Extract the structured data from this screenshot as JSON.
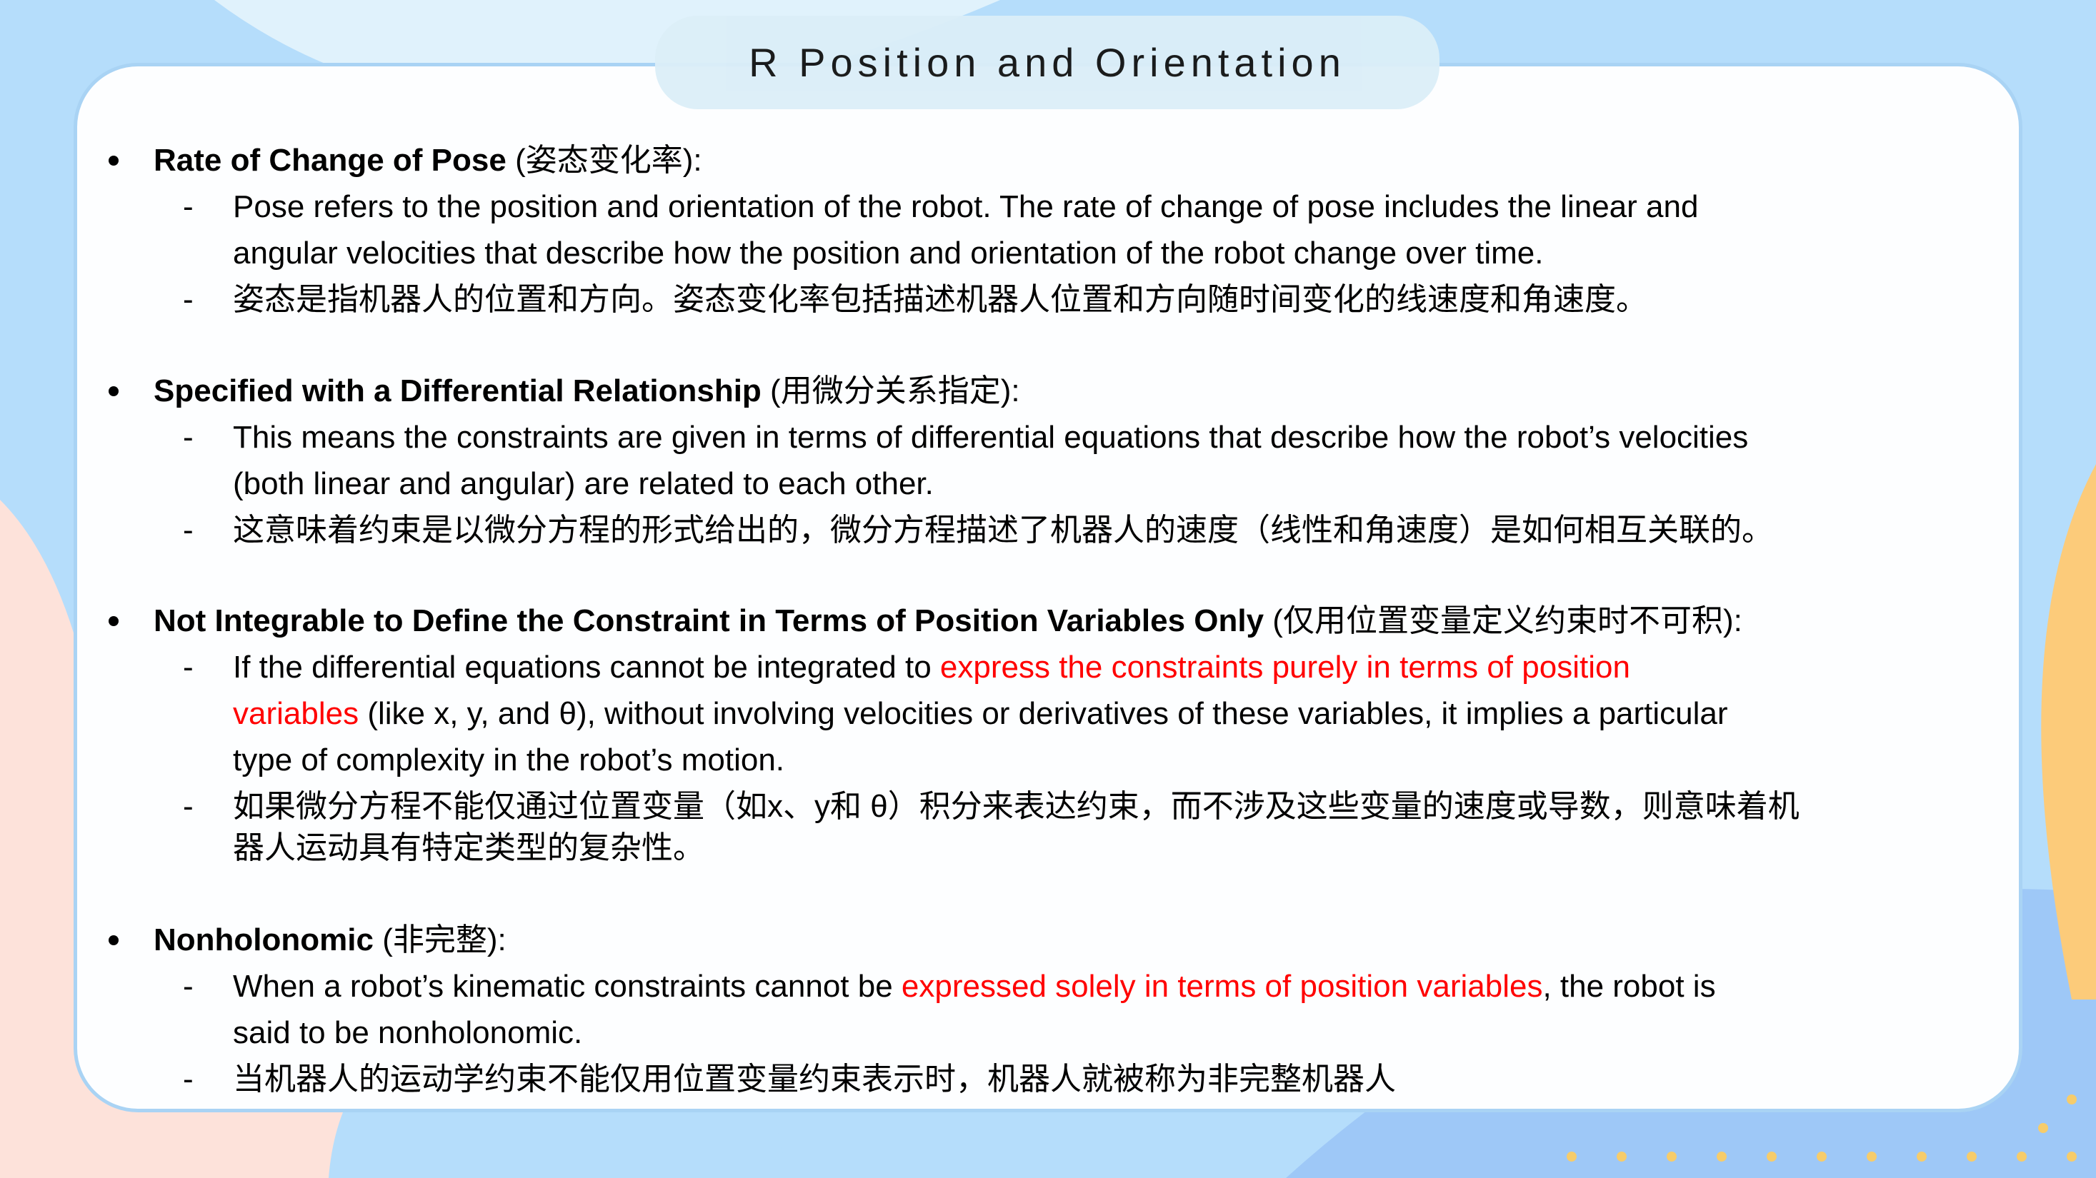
{
  "title": "R Position and Orientation",
  "colors": {
    "highlight": "#ff0000",
    "card_border": "#a9d3f4",
    "background": "#b5ddfb"
  },
  "sections": [
    {
      "heading": "Rate of Change of Pose",
      "heading_suffix": " (姿态变化率):",
      "items": [
        [
          [
            {
              "t": "Pose refers to the position and orientation of the robot. The rate of change of pose includes the linear and"
            }
          ],
          [
            {
              "t": "angular velocities that describe how the position and orientation of the robot change over time."
            }
          ]
        ],
        [
          [
            {
              "t": "姿态是指机器人的位置和方向。姿态变化率包括描述机器人位置和方向随时间变化的线速度和角速度。"
            }
          ]
        ]
      ]
    },
    {
      "heading": "Specified with a Differential Relationship",
      "heading_suffix": " (用微分关系指定):",
      "items": [
        [
          [
            {
              "t": "This means the constraints are given in terms of differential equations that describe how the robot’s velocities"
            }
          ],
          [
            {
              "t": "(both linear and angular) are related to each other."
            }
          ]
        ],
        [
          [
            {
              "t": "这意味着约束是以微分方程的形式给出的，微分方程描述了机器人的速度（线性和角速度）是如何相互关联的。"
            }
          ]
        ]
      ]
    },
    {
      "heading": "Not Integrable to Define the Constraint in Terms of Position Variables Only",
      "heading_suffix": " (仅用位置变量定义约束时不可积):",
      "items": [
        [
          [
            {
              "t": "If the differential equations cannot be integrated to "
            },
            {
              "t": "express the constraints purely in terms of position",
              "red": true
            }
          ],
          [
            {
              "t": "variables",
              "red": true
            },
            {
              "t": " (like x, y, and θ), without involving velocities or derivatives of these variables, it implies a particular"
            }
          ],
          [
            {
              "t": "type of complexity in the robot’s motion."
            }
          ]
        ],
        [
          [
            {
              "t": "如果微分方程不能仅通过位置变量（如x、y和 θ）积分来表达约束，而不涉及这些变量的速度或导数，则意味着机"
            }
          ],
          [
            {
              "t": "器人运动具有特定类型的复杂性。"
            }
          ]
        ]
      ]
    },
    {
      "heading": "Nonholonomic",
      "heading_suffix": " (非完整):",
      "items": [
        [
          [
            {
              "t": "When a robot’s kinematic constraints cannot be "
            },
            {
              "t": "expressed solely in terms of position variables",
              "red": true
            },
            {
              "t": ", the robot is"
            }
          ],
          [
            {
              "t": "said to be nonholonomic."
            }
          ]
        ],
        [
          [
            {
              "t": "当机器人的运动学约束不能仅用位置变量约束表示时，机器人就被称为非完整机器人"
            }
          ]
        ]
      ]
    }
  ]
}
